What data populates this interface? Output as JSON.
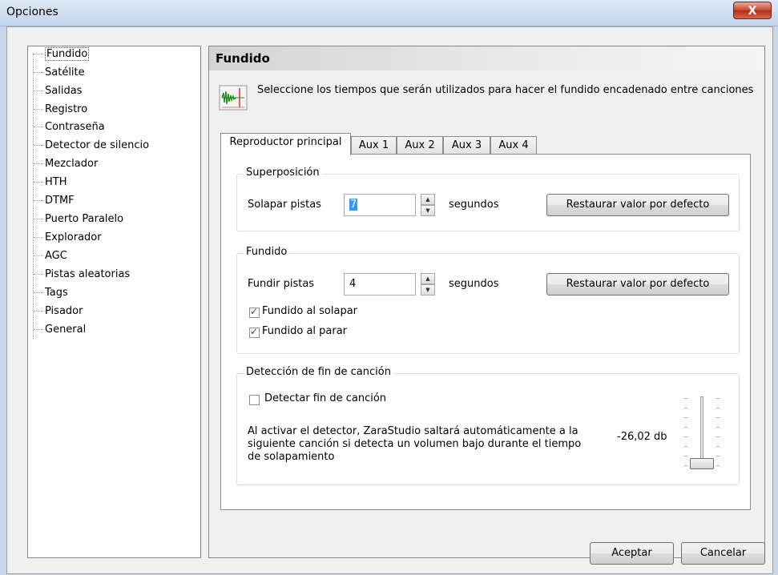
{
  "window": {
    "title": "Opciones",
    "close_glyph": "X"
  },
  "tree": {
    "items": [
      {
        "label": "Fundido",
        "selected": true
      },
      {
        "label": "Satélite"
      },
      {
        "label": "Salidas"
      },
      {
        "label": "Registro"
      },
      {
        "label": "Contraseña"
      },
      {
        "label": "Detector de silencio"
      },
      {
        "label": "Mezclador"
      },
      {
        "label": "HTH"
      },
      {
        "label": "DTMF"
      },
      {
        "label": "Puerto Paralelo"
      },
      {
        "label": "Explorador"
      },
      {
        "label": "AGC"
      },
      {
        "label": "Pistas aleatorias"
      },
      {
        "label": "Tags"
      },
      {
        "label": "Pisador"
      },
      {
        "label": "General"
      }
    ]
  },
  "panel": {
    "title": "Fundido",
    "icon": "waveform-icon",
    "description": "Seleccione los tiempos que serán utilizados para hacer el fundido encadenado entre canciones"
  },
  "tabs": [
    {
      "label": "Reproductor principal",
      "active": true
    },
    {
      "label": "Aux 1"
    },
    {
      "label": "Aux 2"
    },
    {
      "label": "Aux 3"
    },
    {
      "label": "Aux 4"
    }
  ],
  "superposicion": {
    "title": "Superposición",
    "label": "Solapar pistas",
    "value": "7",
    "unit": "segundos",
    "reset_label": "Restaurar valor por defecto"
  },
  "fundido": {
    "title": "Fundido",
    "label": "Fundir pistas",
    "value": "4",
    "unit": "segundos",
    "reset_label": "Restaurar valor por defecto",
    "check_solapar": {
      "label": "Fundido al solapar",
      "checked": true
    },
    "check_parar": {
      "label": "Fundido al parar",
      "checked": true
    }
  },
  "deteccion": {
    "title": "Detección de fin de canción",
    "check_label": "Detectar fin de canción",
    "checked": false,
    "info_line1": "Al activar el detector, ZaraStudio saltará automáticamente a la",
    "info_line2": "siguiente canción si detecta un volumen bajo durante el tiempo",
    "info_line3": "de solapamiento",
    "level_text": "-26,02 db"
  },
  "footer": {
    "ok_label": "Aceptar",
    "cancel_label": "Cancelar"
  }
}
